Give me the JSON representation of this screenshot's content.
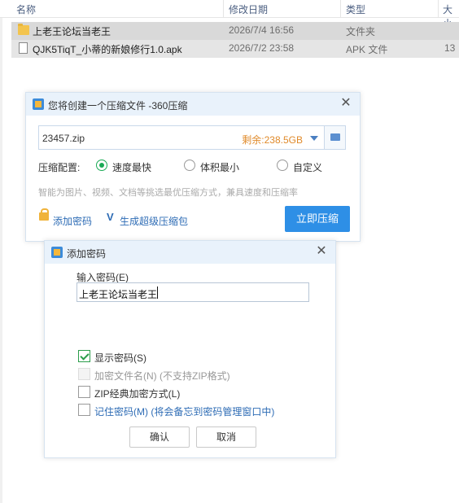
{
  "explorer": {
    "columns": {
      "name": "名称",
      "date": "修改日期",
      "type": "类型",
      "size": "大小"
    },
    "files": [
      {
        "name": "上老王论坛当老王",
        "date": "2026/7/4 16:56",
        "type": "文件夹",
        "size": ""
      },
      {
        "name": "QJK5TiqT_小蒂的新娘修行1.0.apk",
        "date": "2026/7/2 23:58",
        "type": "APK 文件",
        "size": "13"
      }
    ]
  },
  "compress_dialog": {
    "title": "您将创建一个压缩文件 -360压缩",
    "filename": "23457.zip",
    "remaining": "剩余:238.5GB",
    "config_label": "压缩配置:",
    "options": [
      "速度最快",
      "体积最小",
      "自定义"
    ],
    "selected_option": "速度最快",
    "hint": "智能为图片、视频、文档等挑选最优压缩方式，兼具速度和压缩率",
    "add_password_link": "添加密码",
    "super_compress_link": "生成超级压缩包",
    "compress_button": "立即压缩"
  },
  "password_dialog": {
    "title": "添加密码",
    "input_label": "输入密码(E)",
    "password_value": "上老王论坛当老王",
    "checkboxes": [
      {
        "label": "显示密码(S)",
        "checked": true,
        "disabled": false
      },
      {
        "label": "加密文件名(N) (不支持ZIP格式)",
        "checked": false,
        "disabled": true
      },
      {
        "label": "ZIP经典加密方式(L)",
        "checked": false,
        "disabled": false
      },
      {
        "label": "记住密码(M) (将会备忘到密码管理窗口中)",
        "checked": false,
        "disabled": false
      }
    ],
    "ok_button": "确认",
    "cancel_button": "取消"
  },
  "colors": {
    "accent": "#2e8fe6",
    "check_green": "#1aaa55",
    "remaining_orange": "#e08a2a",
    "link_blue": "#2e6cb5"
  }
}
